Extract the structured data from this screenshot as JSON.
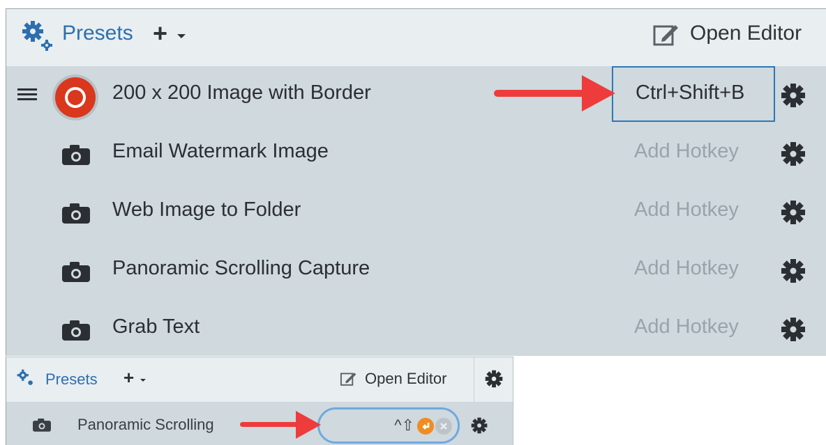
{
  "header": {
    "presets_label": "Presets",
    "add_symbol": "+",
    "open_editor_label": "Open Editor"
  },
  "presets": [
    {
      "name": "200 x 200 Image with Border",
      "hotkey": "Ctrl+Shift+B",
      "icon": "record-icon",
      "selected": true
    },
    {
      "name": "Email Watermark Image",
      "hotkey": "Add Hotkey",
      "icon": "camera-icon"
    },
    {
      "name": "Web Image to Folder",
      "hotkey": "Add Hotkey",
      "icon": "camera-icon"
    },
    {
      "name": "Panoramic Scrolling Capture",
      "hotkey": "Add Hotkey",
      "icon": "camera-icon"
    },
    {
      "name": "Grab Text",
      "hotkey": "Add Hotkey",
      "icon": "camera-icon"
    }
  ],
  "small_panel": {
    "presets_label": "Presets",
    "add_symbol": "+",
    "open_editor_label": "Open Editor",
    "row_label": "Panoramic Scrolling",
    "hotkey_entry": "^⇧"
  },
  "colors": {
    "accent_blue": "#2d6fae",
    "panel_bg": "#cfd9de",
    "header_bg": "#e9eef1",
    "arrow_red": "#ee3b3b",
    "record_red": "#d9381e",
    "confirm_orange": "#f08c22"
  }
}
